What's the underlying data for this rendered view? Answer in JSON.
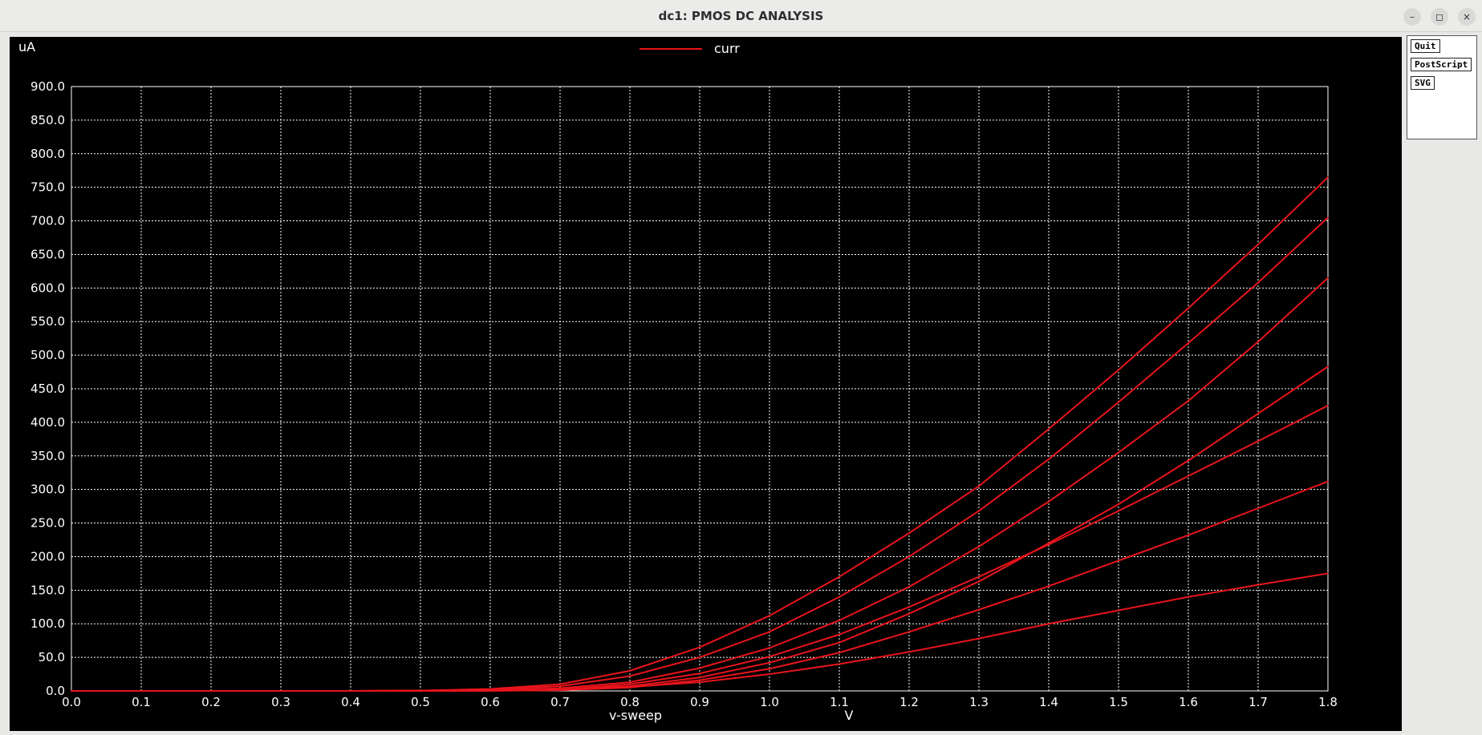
{
  "window": {
    "title": "dc1: PMOS DC ANALYSIS",
    "controls": {
      "minimize": "–",
      "maximize": "◻",
      "close": "×"
    }
  },
  "side_panel": {
    "buttons": [
      "Quit",
      "PostScript",
      "SVG"
    ]
  },
  "colors": {
    "background": "#000000",
    "grid": "#ffffff",
    "trace": "#e8141c",
    "text": "#ffffff"
  },
  "chart_data": {
    "type": "line",
    "ylabel": "uA",
    "xlabel": "v-sweep",
    "xunit": "V",
    "legend": "curr",
    "xlim": [
      0,
      1.8
    ],
    "ylim": [
      0,
      900
    ],
    "xticks": [
      "0.0",
      "0.1",
      "0.2",
      "0.3",
      "0.4",
      "0.5",
      "0.6",
      "0.7",
      "0.8",
      "0.9",
      "1.0",
      "1.1",
      "1.2",
      "1.3",
      "1.4",
      "1.5",
      "1.6",
      "1.7",
      "1.8"
    ],
    "yticks": [
      "0.0",
      "50.0",
      "100.0",
      "150.0",
      "200.0",
      "250.0",
      "300.0",
      "350.0",
      "400.0",
      "450.0",
      "500.0",
      "550.0",
      "600.0",
      "650.0",
      "700.0",
      "750.0",
      "800.0",
      "850.0",
      "900.0"
    ],
    "series": [
      {
        "x": [
          0,
          0.4,
          0.5,
          0.6,
          0.7,
          0.8,
          0.9,
          1.0,
          1.1,
          1.2,
          1.3,
          1.4,
          1.5,
          1.6,
          1.7,
          1.8
        ],
        "values": [
          0,
          0,
          0.5,
          3,
          10,
          30,
          65,
          112,
          170,
          235,
          305,
          390,
          478,
          570,
          665,
          765
        ]
      },
      {
        "x": [
          0,
          0.4,
          0.5,
          0.6,
          0.7,
          0.8,
          0.9,
          1.0,
          1.1,
          1.2,
          1.3,
          1.4,
          1.5,
          1.6,
          1.7,
          1.8
        ],
        "values": [
          0,
          0,
          0.5,
          2,
          7,
          22,
          50,
          88,
          140,
          200,
          268,
          345,
          430,
          518,
          608,
          705
        ]
      },
      {
        "x": [
          0,
          0.4,
          0.5,
          0.6,
          0.7,
          0.8,
          0.9,
          1.0,
          1.1,
          1.2,
          1.3,
          1.4,
          1.5,
          1.6,
          1.7,
          1.8
        ],
        "values": [
          0,
          0,
          0.3,
          1,
          4,
          13,
          34,
          64,
          105,
          155,
          215,
          282,
          355,
          432,
          520,
          615
        ]
      },
      {
        "x": [
          0,
          0.4,
          0.5,
          0.6,
          0.7,
          0.8,
          0.9,
          1.0,
          1.1,
          1.2,
          1.3,
          1.4,
          1.5,
          1.6,
          1.7,
          1.8
        ],
        "values": [
          0,
          0,
          0.2,
          0.5,
          2,
          7,
          20,
          42,
          72,
          115,
          163,
          220,
          278,
          343,
          413,
          483
        ]
      },
      {
        "x": [
          0,
          0.5,
          0.6,
          0.7,
          0.8,
          0.9,
          1.0,
          1.1,
          1.2,
          1.3,
          1.4,
          1.5,
          1.6,
          1.7,
          1.8
        ],
        "values": [
          0,
          0,
          0.5,
          2,
          10,
          26,
          51,
          84,
          125,
          170,
          218,
          268,
          320,
          372,
          425
        ]
      },
      {
        "x": [
          0,
          0.5,
          0.6,
          0.7,
          0.8,
          0.9,
          1.0,
          1.1,
          1.2,
          1.3,
          1.4,
          1.5,
          1.6,
          1.7,
          1.8
        ],
        "values": [
          0,
          0,
          0.3,
          1,
          5,
          16,
          33,
          57,
          88,
          121,
          156,
          194,
          232,
          272,
          312
        ]
      },
      {
        "x": [
          0,
          0.55,
          0.6,
          0.7,
          0.8,
          0.9,
          1.0,
          1.1,
          1.2,
          1.3,
          1.4,
          1.5,
          1.6,
          1.7,
          1.8
        ],
        "values": [
          0,
          0,
          0.2,
          1,
          6,
          13,
          25,
          40,
          58,
          78,
          100,
          120,
          140,
          158,
          175
        ]
      }
    ]
  }
}
